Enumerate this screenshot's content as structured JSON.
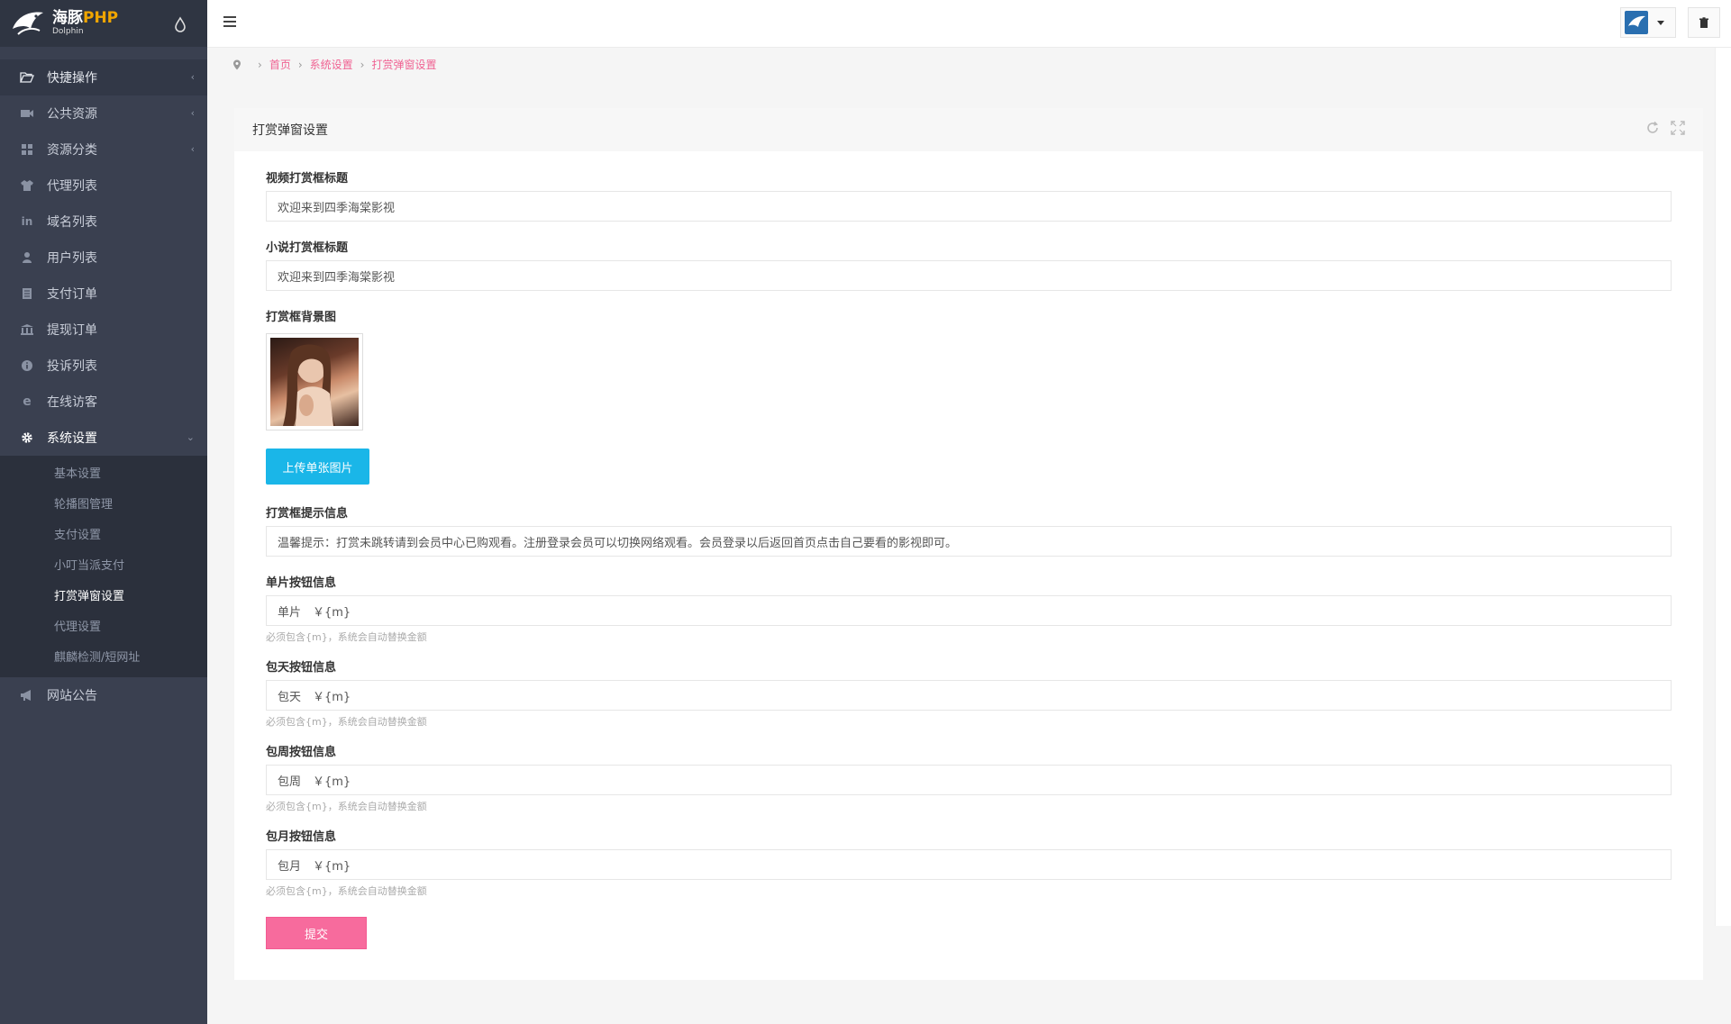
{
  "brand": {
    "name": "海豚",
    "name_suffix": "PHP",
    "sub": "Dolphin"
  },
  "sidebar": {
    "items": [
      {
        "label": "快捷操作",
        "icon": "folder-open-icon"
      },
      {
        "label": "公共资源",
        "icon": "video-camera-icon"
      },
      {
        "label": "资源分类",
        "icon": "grid-icon"
      },
      {
        "label": "代理列表",
        "icon": "shirt-icon"
      },
      {
        "label": "域名列表",
        "icon": "linkedin-icon"
      },
      {
        "label": "用户列表",
        "icon": "user-icon"
      },
      {
        "label": "支付订单",
        "icon": "list-icon"
      },
      {
        "label": "提现订单",
        "icon": "bank-icon"
      },
      {
        "label": "投诉列表",
        "icon": "info-icon"
      },
      {
        "label": "在线访客",
        "icon": "ie-icon"
      },
      {
        "label": "系统设置",
        "icon": "gear-icon"
      }
    ],
    "submenu": [
      {
        "label": "基本设置"
      },
      {
        "label": "轮播图管理"
      },
      {
        "label": "支付设置"
      },
      {
        "label": "小叮当派支付"
      },
      {
        "label": "打赏弹窗设置"
      },
      {
        "label": "代理设置"
      },
      {
        "label": "麒麟检测/短网址"
      }
    ],
    "after": [
      {
        "label": "网站公告",
        "icon": "bullhorn-icon"
      }
    ]
  },
  "breadcrumb": {
    "home": "首页",
    "level1": "系统设置",
    "level2": "打赏弹窗设置"
  },
  "panel": {
    "title": "打赏弹窗设置"
  },
  "form": {
    "video_title": {
      "label": "视频打赏框标题",
      "value": "欢迎来到四季海棠影视"
    },
    "novel_title": {
      "label": "小说打赏框标题",
      "value": "欢迎来到四季海棠影视"
    },
    "bg_image": {
      "label": "打赏框背景图",
      "upload_label": "上传单张图片"
    },
    "tip": {
      "label": "打赏框提示信息",
      "value": "温馨提示：打赏未跳转请到会员中心已购观看。注册登录会员可以切换网络观看。会员登录以后返回首页点击自己要看的影视即可。"
    },
    "single": {
      "label": "单片按钮信息",
      "value": "单片　￥{m}",
      "help": "必须包含{m}，系统会自动替换金额"
    },
    "daily": {
      "label": "包天按钮信息",
      "value": "包天　￥{m}",
      "help": "必须包含{m}，系统会自动替换金额"
    },
    "weekly": {
      "label": "包周按钮信息",
      "value": "包周　￥{m}",
      "help": "必须包含{m}，系统会自动替换金额"
    },
    "monthly": {
      "label": "包月按钮信息",
      "value": "包月　￥{m}",
      "help": "必须包含{m}，系统会自动替换金额"
    },
    "submit_label": "提交"
  },
  "colors": {
    "sidebar_bg": "#3a4050",
    "accent_pink": "#f76b9d",
    "upload_blue": "#1ab6e8"
  }
}
